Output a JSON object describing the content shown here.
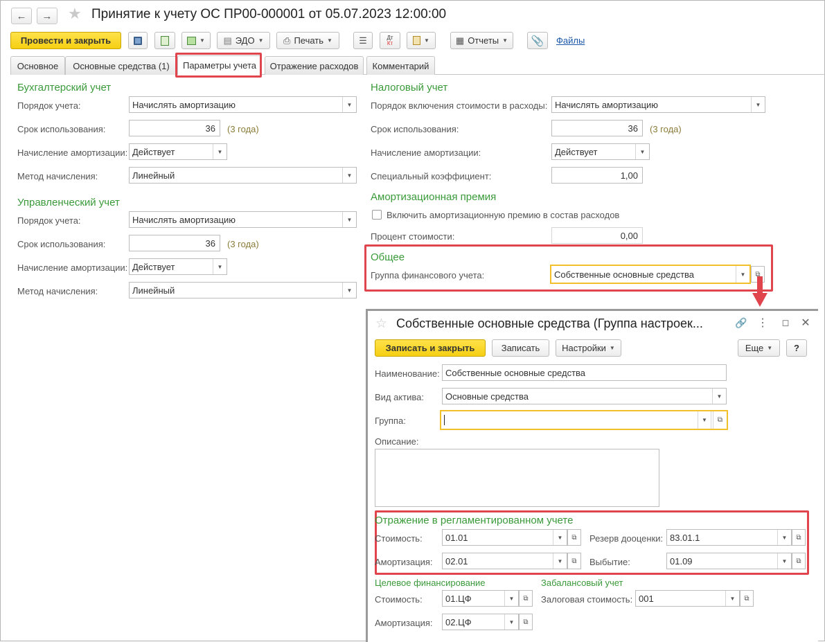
{
  "window": {
    "title": "Принятие к учету ОС ПР00-000001 от 05.07.2023 12:00:00"
  },
  "toolbar": {
    "post_close": "Провести и закрыть",
    "edo": "ЭДО",
    "print": "Печать",
    "reports": "Отчеты",
    "files": "Файлы",
    "dt_kt_top": "Дт",
    "dt_kt_bottom": "Кт"
  },
  "tabs": [
    {
      "label": "Основное"
    },
    {
      "label": "Основные средства (1)"
    },
    {
      "label": "Параметры учета"
    },
    {
      "label": "Отражение расходов"
    },
    {
      "label": "Комментарий"
    }
  ],
  "accounting": {
    "title": "Бухгалтерский учет",
    "order_label": "Порядок учета:",
    "order_value": "Начислять амортизацию",
    "term_label": "Срок использования:",
    "term_value": "36",
    "term_hint": "(3 года)",
    "dep_label": "Начисление амортизации:",
    "dep_value": "Действует",
    "method_label": "Метод начисления:",
    "method_value": "Линейный"
  },
  "management": {
    "title": "Управленческий учет",
    "order_label": "Порядок учета:",
    "order_value": "Начислять амортизацию",
    "term_label": "Срок использования:",
    "term_value": "36",
    "term_hint": "(3 года)",
    "dep_label": "Начисление амортизации:",
    "dep_value": "Действует",
    "method_label": "Метод начисления:",
    "method_value": "Линейный"
  },
  "tax": {
    "title": "Налоговый учет",
    "order_label": "Порядок включения стоимости в расходы:",
    "order_value": "Начислять амортизацию",
    "term_label": "Срок использования:",
    "term_value": "36",
    "term_hint": "(3 года)",
    "dep_label": "Начисление амортизации:",
    "dep_value": "Действует",
    "coef_label": "Специальный коэффициент:",
    "coef_value": "1,00"
  },
  "premium": {
    "title": "Амортизационная премия",
    "checkbox_label": "Включить амортизационную премию в состав расходов",
    "percent_label": "Процент стоимости:",
    "percent_value": "0,00"
  },
  "general": {
    "title": "Общее",
    "group_label": "Группа финансового учета:",
    "group_value": "Собственные основные средства"
  },
  "dialog": {
    "title": "Собственные основные средства (Группа настроек...",
    "write_close": "Записать и закрыть",
    "write": "Записать",
    "settings": "Настройки",
    "more": "Еще",
    "help": "?",
    "name_label": "Наименование:",
    "name_value": "Собственные основные средства",
    "asset_label": "Вид актива:",
    "asset_value": "Основные средства",
    "group_label": "Группа:",
    "group_value": "",
    "desc_label": "Описание:",
    "reg_title": "Отражение в регламентированном учете",
    "cost_label": "Стоимость:",
    "cost_value": "01.01",
    "amort_label": "Амортизация:",
    "amort_value": "02.01",
    "reserve_label": "Резерв дооценки:",
    "reserve_value": "83.01.1",
    "disposal_label": "Выбытие:",
    "disposal_value": "01.09",
    "target_title": "Целевое финансирование",
    "offbal_title": "Забалансовый учет",
    "tcost_label": "Стоимость:",
    "tcost_value": "01.ЦФ",
    "tamort_label": "Амортизация:",
    "tamort_value": "02.ЦФ",
    "pledge_label": "Залоговая стоимость:",
    "pledge_value": "001"
  },
  "colors": {
    "accent_yellow": "#f5cf12",
    "section_green": "#3a9a3a",
    "highlight_red": "#e0454d",
    "link_blue": "#1a55a8"
  }
}
